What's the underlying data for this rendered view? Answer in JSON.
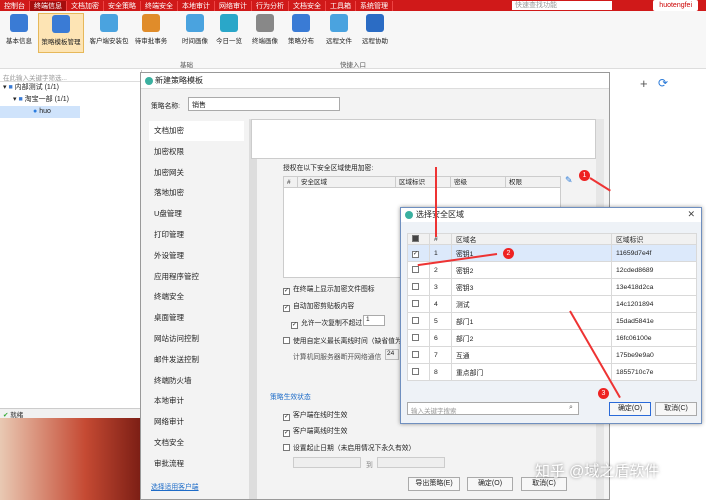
{
  "menubar": {
    "items": [
      "控制台",
      "终端信息",
      "文档加密",
      "安全策略",
      "终端安全",
      "本地审计",
      "网络审计",
      "行为分析",
      "文档安全",
      "工具箱",
      "系统管理"
    ],
    "active": 1,
    "search_placeholder": "快速查找功能",
    "user": "huotengfei"
  },
  "ribbon": {
    "buttons": [
      "基本信息",
      "策略模板管理",
      "客户端安装包",
      "待审批事务",
      "时间画像",
      "今日一览",
      "终端画像",
      "策略分布",
      "远程文件",
      "远程协助"
    ],
    "selected": 1,
    "groups": [
      "基础",
      "快捷入口"
    ]
  },
  "tree": {
    "filter_placeholder": "在此输入关键字筛选...",
    "nodes": [
      "内部测试 (1/1)",
      "淘宝一部 (1/1)",
      "huo"
    ]
  },
  "status": "就绪",
  "dialog": {
    "title": "新建策略模板",
    "name_label": "策略名称:",
    "name_value": "销售",
    "nav": [
      "文档加密",
      "加密权限",
      "加密网关",
      "落地加密",
      "U盘管理",
      "打印管理",
      "外设管理",
      "应用程序管控",
      "终端安全",
      "桌面管理",
      "网站访问控制",
      "邮件发送控制",
      "终端防火墙",
      "本地审计",
      "网络审计",
      "文档安全",
      "审批流程"
    ],
    "auth_label": "授权在以下安全区域使用加密:",
    "table_headers": [
      "#",
      "安全区域",
      "区域标识",
      "密级",
      "权限"
    ],
    "options": [
      "在终端上显示加密文件图标",
      "自动加密剪贴板内容",
      "允许一次复制不超过",
      "使用自定义最长离线时间（缺省值为",
      "计算机同服务器断开网络通信"
    ],
    "copy_limit": "1",
    "offline_value": "24",
    "effect_title": "策略生效状态",
    "effect_options": [
      "客户端在线时生效",
      "客户端离线时生效",
      "设置起止日期（未启用情况下永久有效）"
    ],
    "date_from": "",
    "date_to_label": "到",
    "select_client": "选择适用客户端",
    "export": "导出策略(E)",
    "ok": "确定(O)",
    "cancel": "取消(C)"
  },
  "select_dialog": {
    "title": "选择安全区域",
    "headers": [
      "",
      "#",
      "区域名",
      "区域标识"
    ],
    "rows": [
      {
        "n": "1",
        "name": "密钥1",
        "id": "11659d7e4f",
        "checked": true
      },
      {
        "n": "2",
        "name": "密钥2",
        "id": "12cded8689",
        "checked": false
      },
      {
        "n": "3",
        "name": "密钥3",
        "id": "13e418d2ca",
        "checked": false
      },
      {
        "n": "4",
        "name": "测试",
        "id": "14c1201894",
        "checked": false
      },
      {
        "n": "5",
        "name": "部门1",
        "id": "15dad5841e",
        "checked": false
      },
      {
        "n": "6",
        "name": "部门2",
        "id": "16fc06100e",
        "checked": false
      },
      {
        "n": "7",
        "name": "互通",
        "id": "175be9e9a0",
        "checked": false
      },
      {
        "n": "8",
        "name": "重点部门",
        "id": "1855710c7e",
        "checked": false
      }
    ],
    "search_placeholder": "输入关键字搜索",
    "ok": "确定(O)",
    "cancel": "取消(C)"
  },
  "markers": [
    "1",
    "2",
    "3"
  ],
  "watermark": "知乎 @域之盾软件",
  "colors": {
    "menubar": "#d01919",
    "marker": "#e22222",
    "teal": "#3ab0a0"
  }
}
